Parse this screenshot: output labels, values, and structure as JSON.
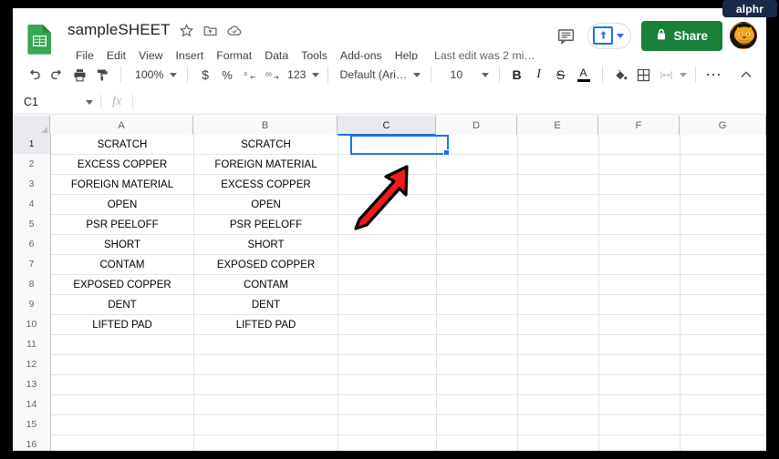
{
  "app": {
    "name": "Google Sheets",
    "logo_icon": "sheets-doc-icon"
  },
  "header": {
    "doc_title": "sampleSHEET",
    "title_icons": [
      {
        "name": "star-icon",
        "glyph": "star"
      },
      {
        "name": "move-to-folder-icon",
        "glyph": "folder-move"
      },
      {
        "name": "cloud-saved-icon",
        "glyph": "cloud-check"
      }
    ],
    "menu": [
      "File",
      "Edit",
      "View",
      "Insert",
      "Format",
      "Data",
      "Tools",
      "Add-ons",
      "Help"
    ],
    "last_edit": "Last edit was 2 mi…",
    "comment_icon": "comment-icon",
    "present_icon": "present-upload-icon",
    "present_caret": "chevron-down-icon",
    "share_label": "Share",
    "share_lock_icon": "lock-icon",
    "share_color": "#188038",
    "avatar_name": "user-avatar",
    "watermark": "alphr",
    "watermark_color": "#1b2a4a"
  },
  "toolbar": {
    "undo": "undo-icon",
    "redo": "redo-icon",
    "print": "print-icon",
    "paint_format": "paint-format-icon",
    "zoom_value": "100%",
    "currency": "$",
    "percent": "%",
    "decrease_decimal": ".0",
    "increase_decimal": ".00",
    "number_format": "123",
    "font_family": "Default (Ari…",
    "font_size": "10",
    "bold": "B",
    "italic": "I",
    "strikethrough": "S",
    "text_color": "A",
    "fill_color": "fill-color-icon",
    "borders": "borders-icon",
    "merge_cells": "merge-cells-icon",
    "more": "more-options-icon",
    "collapse": "collapse-toolbar-icon"
  },
  "formula_bar": {
    "name_box": "C1",
    "fx_label": "fx",
    "formula_value": "",
    "formula_placeholder": ""
  },
  "grid": {
    "columns": [
      "A",
      "B",
      "C",
      "D",
      "E",
      "F",
      "G"
    ],
    "selected_column": "C",
    "selected_cell": "C1",
    "rows": [
      1,
      2,
      3,
      4,
      5,
      6,
      7,
      8,
      9,
      10,
      11,
      12,
      13,
      14,
      15,
      16
    ],
    "selected_row": 1,
    "data": [
      {
        "row": 1,
        "A": "SCRATCH",
        "B": "SCRATCH",
        "C": "",
        "D": "",
        "E": "",
        "F": "",
        "G": ""
      },
      {
        "row": 2,
        "A": "EXCESS COPPER",
        "B": "FOREIGN MATERIAL",
        "C": "",
        "D": "",
        "E": "",
        "F": "",
        "G": ""
      },
      {
        "row": 3,
        "A": "FOREIGN MATERIAL",
        "B": "EXCESS COPPER",
        "C": "",
        "D": "",
        "E": "",
        "F": "",
        "G": ""
      },
      {
        "row": 4,
        "A": "OPEN",
        "B": "OPEN",
        "C": "",
        "D": "",
        "E": "",
        "F": "",
        "G": ""
      },
      {
        "row": 5,
        "A": "PSR PEELOFF",
        "B": "PSR PEELOFF",
        "C": "",
        "D": "",
        "E": "",
        "F": "",
        "G": ""
      },
      {
        "row": 6,
        "A": "SHORT",
        "B": "SHORT",
        "C": "",
        "D": "",
        "E": "",
        "F": "",
        "G": ""
      },
      {
        "row": 7,
        "A": "CONTAM",
        "B": "EXPOSED COPPER",
        "C": "",
        "D": "",
        "E": "",
        "F": "",
        "G": ""
      },
      {
        "row": 8,
        "A": "EXPOSED COPPER",
        "B": "CONTAM",
        "C": "",
        "D": "",
        "E": "",
        "F": "",
        "G": ""
      },
      {
        "row": 9,
        "A": "DENT",
        "B": "DENT",
        "C": "",
        "D": "",
        "E": "",
        "F": "",
        "G": ""
      },
      {
        "row": 10,
        "A": "LIFTED PAD",
        "B": "LIFTED PAD",
        "C": "",
        "D": "",
        "E": "",
        "F": "",
        "G": ""
      },
      {
        "row": 11,
        "A": "",
        "B": "",
        "C": "",
        "D": "",
        "E": "",
        "F": "",
        "G": ""
      },
      {
        "row": 12,
        "A": "",
        "B": "",
        "C": "",
        "D": "",
        "E": "",
        "F": "",
        "G": ""
      },
      {
        "row": 13,
        "A": "",
        "B": "",
        "C": "",
        "D": "",
        "E": "",
        "F": "",
        "G": ""
      },
      {
        "row": 14,
        "A": "",
        "B": "",
        "C": "",
        "D": "",
        "E": "",
        "F": "",
        "G": ""
      },
      {
        "row": 15,
        "A": "",
        "B": "",
        "C": "",
        "D": "",
        "E": "",
        "F": "",
        "G": ""
      },
      {
        "row": 16,
        "A": "",
        "B": "",
        "C": "",
        "D": "",
        "E": "",
        "F": "",
        "G": ""
      }
    ]
  },
  "annotation": {
    "arrow_name": "red-arrow-pointer",
    "arrow_color": "#ee1c1c",
    "points_at": "C1"
  },
  "colors": {
    "selection_blue": "#1a73e8",
    "share_green": "#188038",
    "grid_line": "#e2e3e3",
    "header_bg": "#f8f9fa"
  }
}
